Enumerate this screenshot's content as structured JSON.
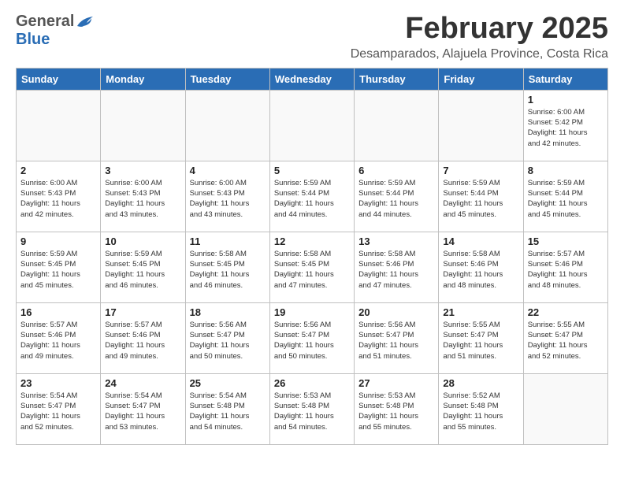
{
  "logo": {
    "general": "General",
    "blue": "Blue"
  },
  "header": {
    "month": "February 2025",
    "location": "Desamparados, Alajuela Province, Costa Rica"
  },
  "weekdays": [
    "Sunday",
    "Monday",
    "Tuesday",
    "Wednesday",
    "Thursday",
    "Friday",
    "Saturday"
  ],
  "weeks": [
    [
      {
        "day": "",
        "info": ""
      },
      {
        "day": "",
        "info": ""
      },
      {
        "day": "",
        "info": ""
      },
      {
        "day": "",
        "info": ""
      },
      {
        "day": "",
        "info": ""
      },
      {
        "day": "",
        "info": ""
      },
      {
        "day": "1",
        "info": "Sunrise: 6:00 AM\nSunset: 5:42 PM\nDaylight: 11 hours\nand 42 minutes."
      }
    ],
    [
      {
        "day": "2",
        "info": "Sunrise: 6:00 AM\nSunset: 5:43 PM\nDaylight: 11 hours\nand 42 minutes."
      },
      {
        "day": "3",
        "info": "Sunrise: 6:00 AM\nSunset: 5:43 PM\nDaylight: 11 hours\nand 43 minutes."
      },
      {
        "day": "4",
        "info": "Sunrise: 6:00 AM\nSunset: 5:43 PM\nDaylight: 11 hours\nand 43 minutes."
      },
      {
        "day": "5",
        "info": "Sunrise: 5:59 AM\nSunset: 5:44 PM\nDaylight: 11 hours\nand 44 minutes."
      },
      {
        "day": "6",
        "info": "Sunrise: 5:59 AM\nSunset: 5:44 PM\nDaylight: 11 hours\nand 44 minutes."
      },
      {
        "day": "7",
        "info": "Sunrise: 5:59 AM\nSunset: 5:44 PM\nDaylight: 11 hours\nand 45 minutes."
      },
      {
        "day": "8",
        "info": "Sunrise: 5:59 AM\nSunset: 5:44 PM\nDaylight: 11 hours\nand 45 minutes."
      }
    ],
    [
      {
        "day": "9",
        "info": "Sunrise: 5:59 AM\nSunset: 5:45 PM\nDaylight: 11 hours\nand 45 minutes."
      },
      {
        "day": "10",
        "info": "Sunrise: 5:59 AM\nSunset: 5:45 PM\nDaylight: 11 hours\nand 46 minutes."
      },
      {
        "day": "11",
        "info": "Sunrise: 5:58 AM\nSunset: 5:45 PM\nDaylight: 11 hours\nand 46 minutes."
      },
      {
        "day": "12",
        "info": "Sunrise: 5:58 AM\nSunset: 5:45 PM\nDaylight: 11 hours\nand 47 minutes."
      },
      {
        "day": "13",
        "info": "Sunrise: 5:58 AM\nSunset: 5:46 PM\nDaylight: 11 hours\nand 47 minutes."
      },
      {
        "day": "14",
        "info": "Sunrise: 5:58 AM\nSunset: 5:46 PM\nDaylight: 11 hours\nand 48 minutes."
      },
      {
        "day": "15",
        "info": "Sunrise: 5:57 AM\nSunset: 5:46 PM\nDaylight: 11 hours\nand 48 minutes."
      }
    ],
    [
      {
        "day": "16",
        "info": "Sunrise: 5:57 AM\nSunset: 5:46 PM\nDaylight: 11 hours\nand 49 minutes."
      },
      {
        "day": "17",
        "info": "Sunrise: 5:57 AM\nSunset: 5:46 PM\nDaylight: 11 hours\nand 49 minutes."
      },
      {
        "day": "18",
        "info": "Sunrise: 5:56 AM\nSunset: 5:47 PM\nDaylight: 11 hours\nand 50 minutes."
      },
      {
        "day": "19",
        "info": "Sunrise: 5:56 AM\nSunset: 5:47 PM\nDaylight: 11 hours\nand 50 minutes."
      },
      {
        "day": "20",
        "info": "Sunrise: 5:56 AM\nSunset: 5:47 PM\nDaylight: 11 hours\nand 51 minutes."
      },
      {
        "day": "21",
        "info": "Sunrise: 5:55 AM\nSunset: 5:47 PM\nDaylight: 11 hours\nand 51 minutes."
      },
      {
        "day": "22",
        "info": "Sunrise: 5:55 AM\nSunset: 5:47 PM\nDaylight: 11 hours\nand 52 minutes."
      }
    ],
    [
      {
        "day": "23",
        "info": "Sunrise: 5:54 AM\nSunset: 5:47 PM\nDaylight: 11 hours\nand 52 minutes."
      },
      {
        "day": "24",
        "info": "Sunrise: 5:54 AM\nSunset: 5:47 PM\nDaylight: 11 hours\nand 53 minutes."
      },
      {
        "day": "25",
        "info": "Sunrise: 5:54 AM\nSunset: 5:48 PM\nDaylight: 11 hours\nand 54 minutes."
      },
      {
        "day": "26",
        "info": "Sunrise: 5:53 AM\nSunset: 5:48 PM\nDaylight: 11 hours\nand 54 minutes."
      },
      {
        "day": "27",
        "info": "Sunrise: 5:53 AM\nSunset: 5:48 PM\nDaylight: 11 hours\nand 55 minutes."
      },
      {
        "day": "28",
        "info": "Sunrise: 5:52 AM\nSunset: 5:48 PM\nDaylight: 11 hours\nand 55 minutes."
      },
      {
        "day": "",
        "info": ""
      }
    ]
  ]
}
